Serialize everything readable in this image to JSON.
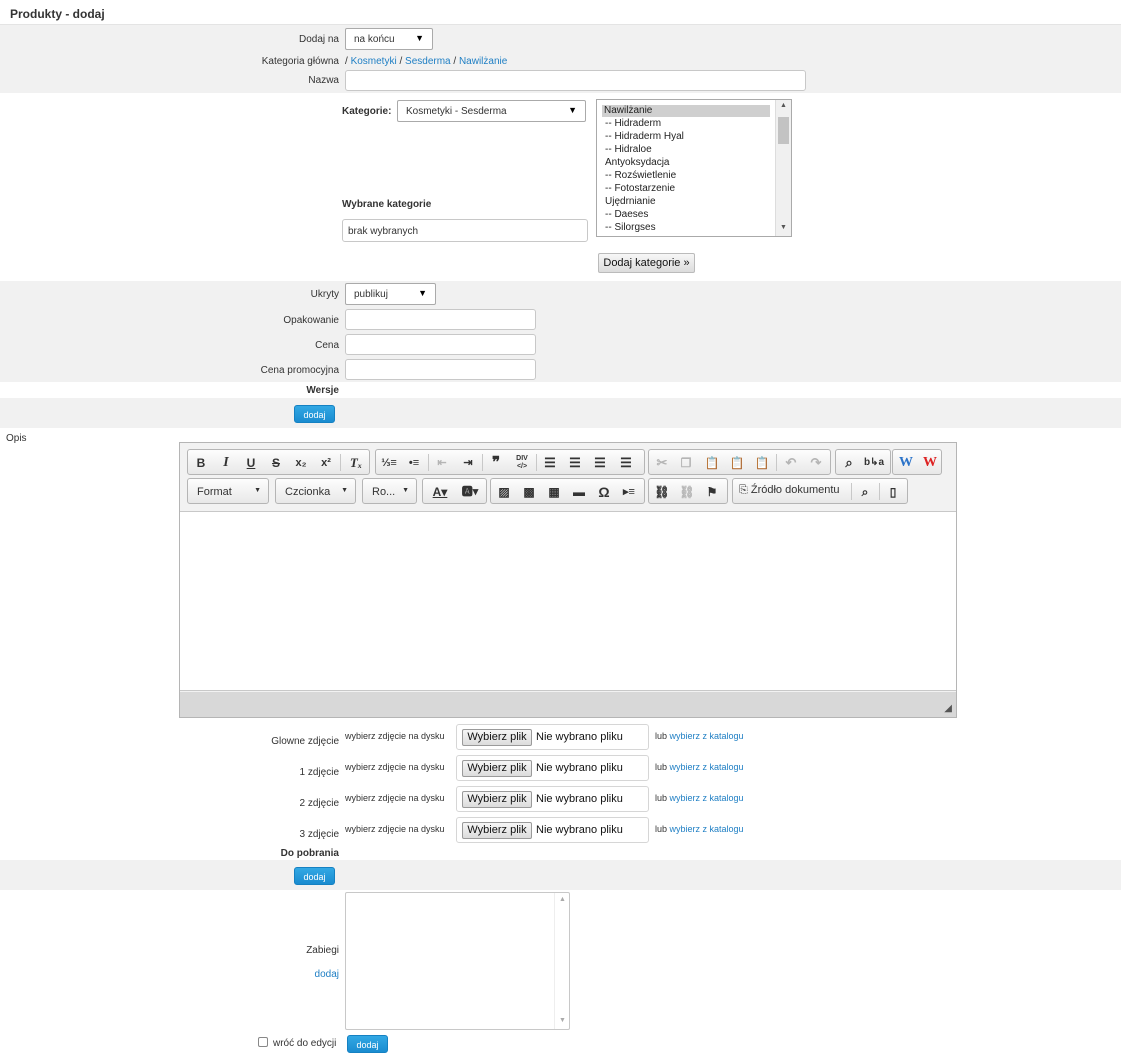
{
  "page": {
    "title": "Produkty - dodaj"
  },
  "form": {
    "dodaj_na": {
      "label": "Dodaj na",
      "value": "na końcu"
    },
    "kategoria_glowna": {
      "label": "Kategoria główna",
      "sep": "/",
      "crumbs": [
        "Kosmetyki",
        "Sesderma",
        "Nawilżanie"
      ]
    },
    "nazwa": {
      "label": "Nazwa",
      "value": ""
    },
    "kategorie": {
      "label": "Kategorie:",
      "select_value": "Kosmetyki - Sesderma",
      "list": [
        "Nawilżanie",
        "-- Hidraderm",
        "-- Hidraderm Hyal",
        "-- Hidraloe",
        "Antyoksydacja",
        "-- Rozświetlenie",
        "-- Fotostarzenie",
        "Ujędrnianie",
        "-- Daeses",
        "-- Silorgses"
      ],
      "selected_heading": "Wybrane kategorie",
      "selected_value": "brak wybranych",
      "add_button": "Dodaj kategorie »"
    },
    "ukryty": {
      "label": "Ukryty",
      "value": "publikuj"
    },
    "opakowanie": {
      "label": "Opakowanie",
      "value": ""
    },
    "cena": {
      "label": "Cena",
      "value": ""
    },
    "cena_promocyjna": {
      "label": "Cena promocyjna",
      "value": ""
    },
    "wersje": {
      "label": "Wersje",
      "add": "dodaj"
    },
    "opis": {
      "label": "Opis",
      "toolbar": {
        "format": "Format",
        "font": "Czcionka",
        "size": "Ro...",
        "source": "Źródło dokumentu"
      }
    },
    "photos": {
      "disk_text": "wybierz zdjęcie na dysku",
      "choose_button": "Wybierz plik",
      "no_file": "Nie wybrano pliku",
      "or": "lub",
      "catalog": "wybierz z katalogu",
      "rows": [
        "Glowne zdjęcie",
        "1 zdjęcie",
        "2 zdjęcie",
        "3 zdjęcie"
      ]
    },
    "do_pobrania": {
      "label": "Do pobrania",
      "add": "dodaj"
    },
    "zabiegi": {
      "label": "Zabiegi",
      "add_link": "dodaj",
      "value": ""
    },
    "footer": {
      "back_label": "wróć do edycji",
      "submit": "dodaj"
    }
  },
  "colors": {
    "accent": "#1a8cd0",
    "link": "#1f7fc4",
    "band": "#f1f1f1"
  }
}
